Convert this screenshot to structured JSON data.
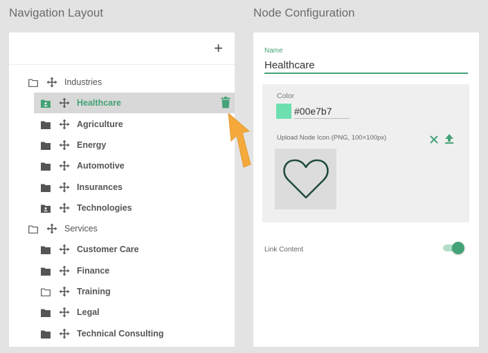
{
  "headings": {
    "navigation": "Navigation Layout",
    "configuration": "Node Configuration"
  },
  "nav": {
    "add_icon": "plus-icon",
    "items": [
      {
        "label": "Industries",
        "level": 0,
        "folder": "outline"
      },
      {
        "label": "Healthcare",
        "level": 1,
        "folder": "person",
        "selected": true
      },
      {
        "label": "Agriculture",
        "level": 1,
        "folder": "filled"
      },
      {
        "label": "Energy",
        "level": 1,
        "folder": "filled"
      },
      {
        "label": "Automotive",
        "level": 1,
        "folder": "filled"
      },
      {
        "label": "Insurances",
        "level": 1,
        "folder": "filled"
      },
      {
        "label": "Technologies",
        "level": 1,
        "folder": "person"
      },
      {
        "label": "Services",
        "level": 0,
        "folder": "outline"
      },
      {
        "label": "Customer Care",
        "level": 1,
        "folder": "filled"
      },
      {
        "label": "Finance",
        "level": 1,
        "folder": "filled"
      },
      {
        "label": "Training",
        "level": 1,
        "folder": "outline"
      },
      {
        "label": "Legal",
        "level": 1,
        "folder": "filled"
      },
      {
        "label": "Technical Consulting",
        "level": 1,
        "folder": "filled"
      }
    ]
  },
  "config": {
    "name_label": "Name",
    "name_value": "Healthcare",
    "color_label": "Color",
    "color_value": "#00e7b7",
    "swatch_color": "#6de0b0",
    "upload_label": "Upload Node Icon (PNG, 100×100px)",
    "preview_icon": "heart-icon",
    "link_label": "Link Content",
    "link_enabled": true
  },
  "colors": {
    "accent": "#43a276"
  }
}
